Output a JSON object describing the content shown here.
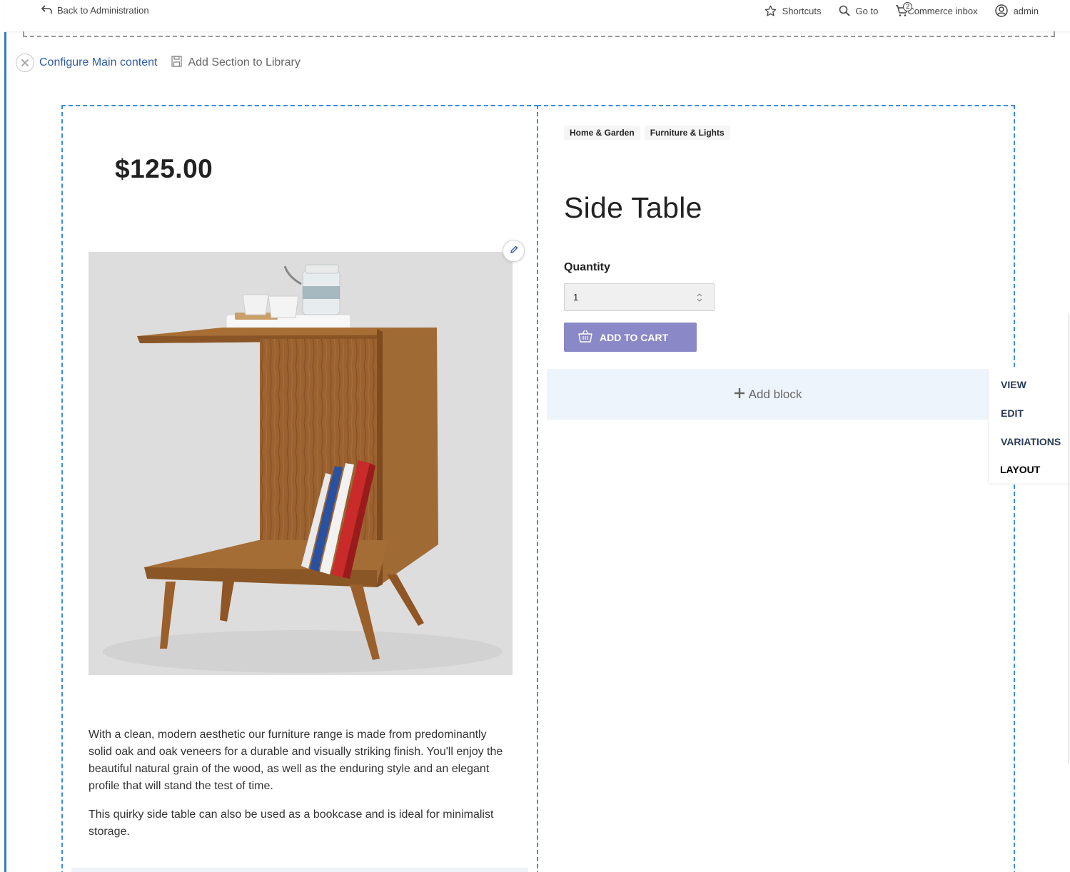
{
  "toolbar": {
    "back_label": "Back to Administration",
    "shortcuts_label": "Shortcuts",
    "goto_label": "Go to",
    "inbox_label": "Commerce inbox",
    "inbox_count": "2",
    "user_label": "admin"
  },
  "section": {
    "configure_label": "Configure Main content",
    "library_label": "Add Section to Library"
  },
  "product": {
    "price": "$125.00",
    "title": "Side Table",
    "categories": [
      "Home & Garden",
      "Furniture & Lights"
    ],
    "quantity_label": "Quantity",
    "quantity_value": "1",
    "add_to_cart_label": "ADD TO CART",
    "description": [
      "With a clean, modern aesthetic our furniture range is made from predominantly solid oak and oak veneers for a durable and visually striking finish. You'll enjoy the beautiful natural grain of the wood, as well as the enduring style and an elegant profile that will stand the test of time.",
      "This quirky side table can also be used as a bookcase and is ideal for minimalist storage."
    ]
  },
  "add_block_label": "Add block",
  "tabs": [
    {
      "label": "VIEW"
    },
    {
      "label": "EDIT"
    },
    {
      "label": "VARIATIONS"
    },
    {
      "label": "LAYOUT"
    }
  ],
  "colors": {
    "accent": "#3b8de0",
    "button": "#8a88c6",
    "link": "#2f5ba8"
  }
}
